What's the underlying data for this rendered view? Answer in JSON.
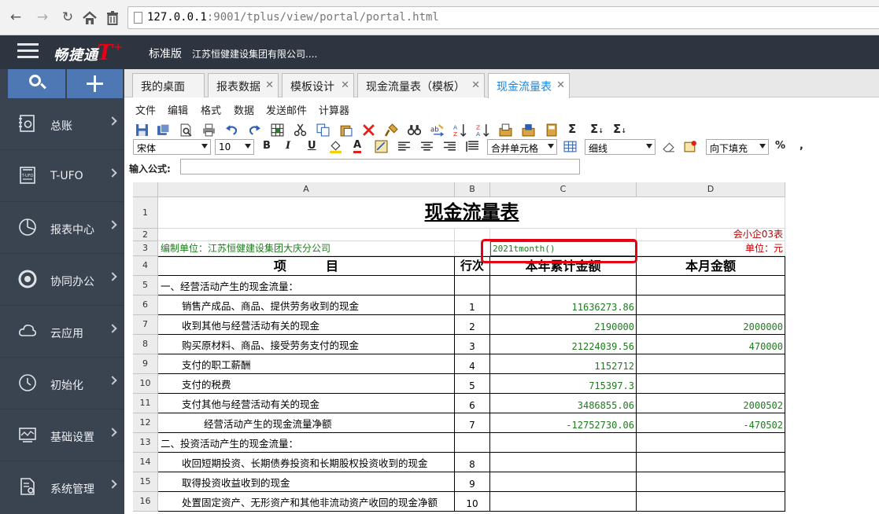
{
  "browser": {
    "url_host": "127.0.0.1",
    "url_rest": ":9001/tplus/view/portal/portal.html"
  },
  "app": {
    "brand_text": "畅捷通",
    "brand_t": "T",
    "brand_plus": "+",
    "edition": "标准版",
    "company": "江苏恒健建设集团有限公司...."
  },
  "sidebar": {
    "items": [
      {
        "label": "总账",
        "icon": "ledger-icon"
      },
      {
        "label": "T-UFO",
        "icon": "ufo-report-icon"
      },
      {
        "label": "报表中心",
        "icon": "pie-chart-icon"
      },
      {
        "label": "协同办公",
        "icon": "collaboration-icon"
      },
      {
        "label": "云应用",
        "icon": "cloud-icon"
      },
      {
        "label": "初始化",
        "icon": "clock-icon"
      },
      {
        "label": "基础设置",
        "icon": "settings-chart-icon"
      },
      {
        "label": "系统管理",
        "icon": "document-gear-icon"
      }
    ]
  },
  "tabs": [
    {
      "label": "我的桌面",
      "closable": false
    },
    {
      "label": "报表数据",
      "closable": true
    },
    {
      "label": "模板设计",
      "closable": true
    },
    {
      "label": "现金流量表（模板）",
      "closable": true
    },
    {
      "label": "现金流量表",
      "closable": true,
      "active": true
    }
  ],
  "menu": [
    "文件",
    "编辑",
    "格式",
    "数据",
    "发送邮件",
    "计算器"
  ],
  "format_bar": {
    "font": "宋体",
    "size": "10",
    "bold": "B",
    "italic": "I",
    "underline": "U",
    "font_color": "A",
    "merge": "合并单元格",
    "border": "细线",
    "fill": "向下填充",
    "percent": "%",
    "comma": ","
  },
  "formula": {
    "label": "输入公式:",
    "value": ""
  },
  "sheet": {
    "columns": [
      "A",
      "B",
      "C",
      "D"
    ],
    "title": "现金流量表",
    "row2_d": "会小企03表",
    "row3_a": "编制单位：江苏恒健建设集团大庆分公司",
    "row3_c": "2021tmonth()",
    "row3_d": "单位：元",
    "header": {
      "item": "项         目",
      "line": "行次",
      "year": "本年累计金额",
      "month": "本月金额"
    },
    "rows": [
      {
        "num": "5",
        "a": "一、经营活动产生的现金流量：",
        "b": "",
        "c": "",
        "d": "",
        "indent": 0
      },
      {
        "num": "6",
        "a": "销售产成品、商品、提供劳务收到的现金",
        "b": "1",
        "c": "11636273.86",
        "d": "",
        "indent": 1
      },
      {
        "num": "7",
        "a": "收到其他与经营活动有关的现金",
        "b": "2",
        "c": "2190000",
        "d": "2000000",
        "indent": 1
      },
      {
        "num": "8",
        "a": "购买原材料、商品、接受劳务支付的现金",
        "b": "3",
        "c": "21224039.56",
        "d": "470000",
        "indent": 1
      },
      {
        "num": "9",
        "a": "支付的职工薪酬",
        "b": "4",
        "c": "1152712",
        "d": "",
        "indent": 1
      },
      {
        "num": "10",
        "a": "支付的税费",
        "b": "5",
        "c": "715397.3",
        "d": "",
        "indent": 1
      },
      {
        "num": "11",
        "a": "支付其他与经营活动有关的现金",
        "b": "6",
        "c": "3486855.06",
        "d": "2000502",
        "indent": 1
      },
      {
        "num": "12",
        "a": "经营活动产生的现金流量净额",
        "b": "7",
        "c": "-12752730.06",
        "d": "-470502",
        "indent": 2
      },
      {
        "num": "13",
        "a": "二、投资活动产生的现金流量：",
        "b": "",
        "c": "",
        "d": "",
        "indent": 0
      },
      {
        "num": "14",
        "a": "收回短期投资、长期债券投资和长期股权投资收到的现金",
        "b": "8",
        "c": "",
        "d": "",
        "indent": 1
      },
      {
        "num": "15",
        "a": "取得投资收益收到的现金",
        "b": "9",
        "c": "",
        "d": "",
        "indent": 1
      },
      {
        "num": "16",
        "a": "处置固定资产、无形资产和其他非流动资产收回的现金净额",
        "b": "10",
        "c": "",
        "d": "",
        "indent": 1
      }
    ]
  }
}
